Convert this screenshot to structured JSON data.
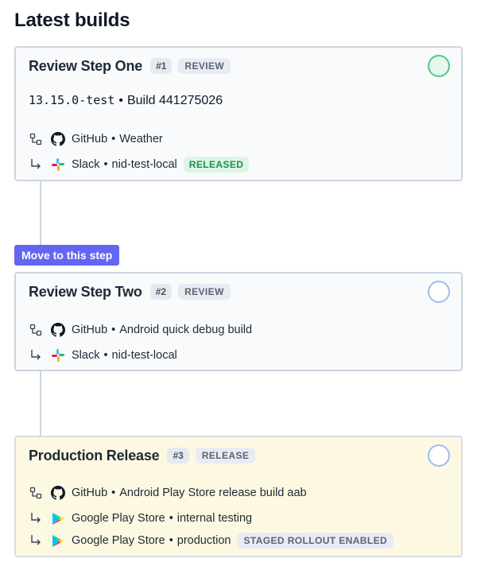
{
  "page": {
    "title": "Latest builds"
  },
  "move_button": {
    "label": "Move to this step"
  },
  "steps": [
    {
      "title": "Review Step One",
      "number": "#1",
      "type": "REVIEW",
      "status": "completed",
      "version": {
        "name": "13.15.0-test",
        "separator": "•",
        "build": "Build 441275026"
      },
      "source": {
        "icon": "github-icon",
        "provider": "GitHub",
        "separator": "•",
        "name": "Weather"
      },
      "destinations": [
        {
          "icon": "slack-icon",
          "provider": "Slack",
          "separator": "•",
          "name": "nid-test-local",
          "badge": "RELEASED"
        }
      ]
    },
    {
      "title": "Review Step Two",
      "number": "#2",
      "type": "REVIEW",
      "status": "pending",
      "source": {
        "icon": "github-icon",
        "provider": "GitHub",
        "separator": "•",
        "name": "Android quick debug build"
      },
      "destinations": [
        {
          "icon": "slack-icon",
          "provider": "Slack",
          "separator": "•",
          "name": "nid-test-local"
        }
      ]
    },
    {
      "title": "Production Release",
      "number": "#3",
      "type": "RELEASE",
      "status": "pending",
      "source": {
        "icon": "github-icon",
        "provider": "GitHub",
        "separator": "•",
        "name": "Android Play Store release build aab"
      },
      "destinations": [
        {
          "icon": "google-play-icon",
          "provider": "Google Play Store",
          "separator": "•",
          "name": "internal testing"
        },
        {
          "icon": "google-play-icon",
          "provider": "Google Play Store",
          "separator": "•",
          "name": "production",
          "badge": "STAGED ROLLOUT ENABLED"
        }
      ]
    }
  ],
  "colors": {
    "accent": "#6366f1",
    "card_border": "#cbd5e1",
    "release_background": "#fdf8e1",
    "released_badge": "#1c8f4d",
    "completed_status": "#4ccc82",
    "pending_status": "#9cbfe8"
  }
}
